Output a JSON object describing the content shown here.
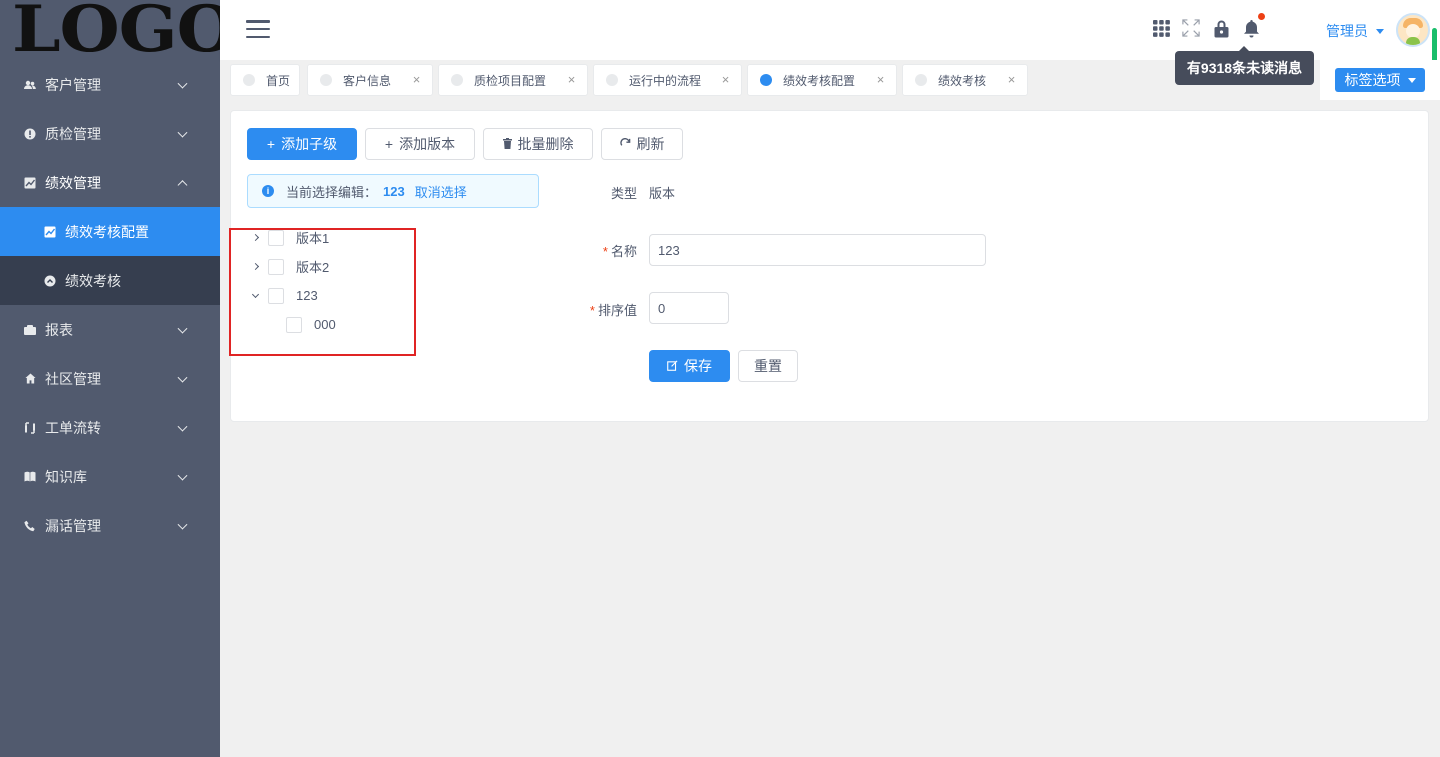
{
  "logo": {
    "text": "LOGO"
  },
  "sidebar": {
    "items": [
      {
        "label": "客户管理",
        "icon": "users-icon"
      },
      {
        "label": "质检管理",
        "icon": "alert-circle-icon"
      },
      {
        "label": "绩效管理",
        "icon": "chart-icon"
      },
      {
        "label": "报表",
        "icon": "folder-icon"
      },
      {
        "label": "社区管理",
        "icon": "home-icon"
      },
      {
        "label": "工单流转",
        "icon": "refresh-icon"
      },
      {
        "label": "知识库",
        "icon": "book-icon"
      },
      {
        "label": "漏话管理",
        "icon": "phone-icon"
      }
    ],
    "submenu": [
      {
        "label": "绩效考核配置",
        "icon": "chart-icon"
      },
      {
        "label": "绩效考核",
        "icon": "chevron-up-circle-icon"
      }
    ]
  },
  "header": {
    "user_name": "管理员",
    "tooltip": "有9318条未读消息",
    "accent_color": "#2d8cf0",
    "notification_dot_color": "#ed4014"
  },
  "tabs": [
    {
      "label": "首页",
      "closable": false,
      "active": false
    },
    {
      "label": "客户信息",
      "closable": true,
      "active": false
    },
    {
      "label": "质检项目配置",
      "closable": true,
      "active": false
    },
    {
      "label": "运行中的流程",
      "closable": true,
      "active": false
    },
    {
      "label": "绩效考核配置",
      "closable": true,
      "active": true
    },
    {
      "label": "绩效考核",
      "closable": true,
      "active": false
    }
  ],
  "tag_options_label": "标签选项",
  "toolbar": {
    "add_child": "添加子级",
    "add_version": "添加版本",
    "batch_delete": "批量删除",
    "refresh": "刷新"
  },
  "alert": {
    "prefix": "当前选择编辑：",
    "selected": "123",
    "cancel": "取消选择"
  },
  "tree": [
    {
      "label": "版本1",
      "expanded": false
    },
    {
      "label": "版本2",
      "expanded": false
    },
    {
      "label": "123",
      "expanded": true,
      "children": [
        {
          "label": "000"
        }
      ]
    }
  ],
  "form": {
    "type_label": "类型",
    "type_value": "版本",
    "name_label": "名称",
    "name_value": "123",
    "sort_label": "排序值",
    "sort_value": "0",
    "save": "保存",
    "reset": "重置"
  }
}
